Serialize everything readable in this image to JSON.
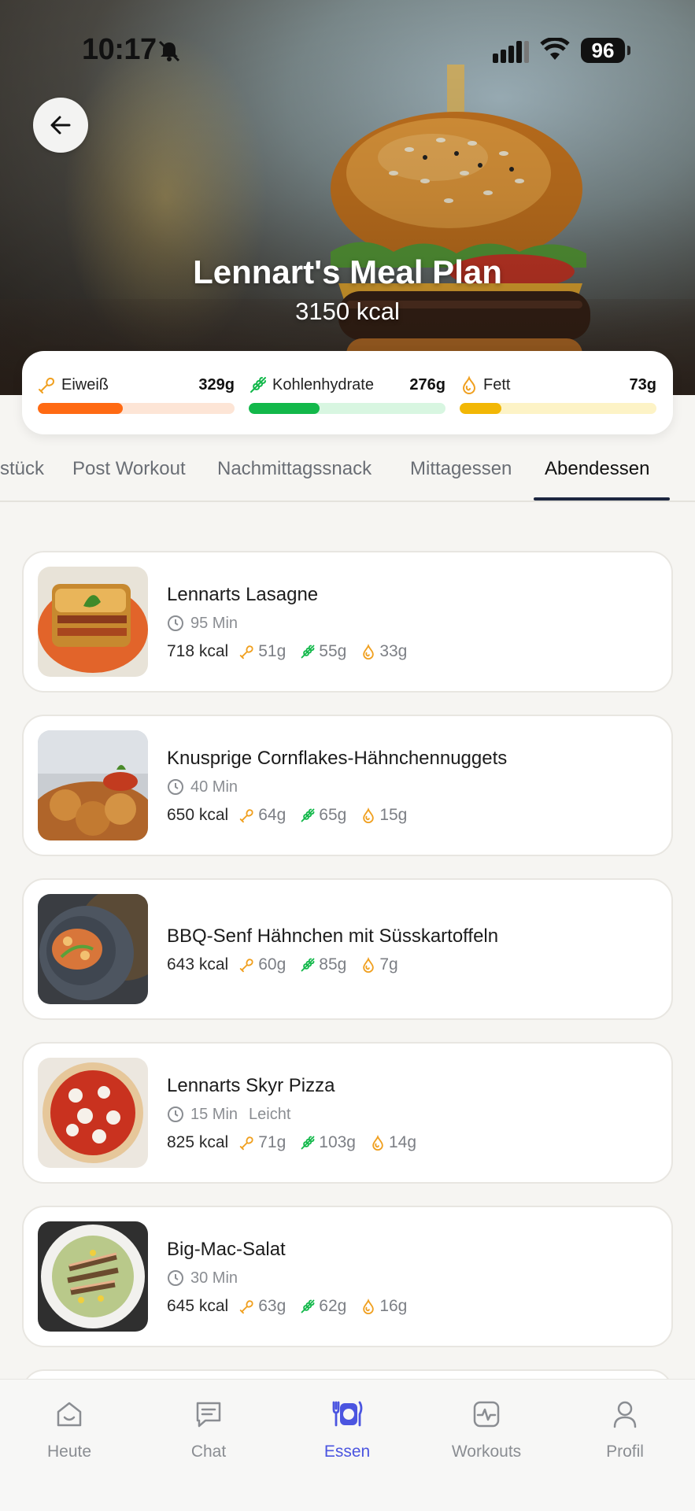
{
  "status_bar": {
    "time": "10:17",
    "battery": "96"
  },
  "header": {
    "title": "Lennart's Meal Plan",
    "kcal": "3150 kcal"
  },
  "macros": [
    {
      "icon": "protein-icon",
      "label": "Eiweiß",
      "value": "329g",
      "fill": 0.43,
      "color": "#ff6a13",
      "track": "#fde5d6"
    },
    {
      "icon": "carbs-icon",
      "label": "Kohlenhydrate",
      "value": "276g",
      "fill": 0.36,
      "color": "#12b84a",
      "track": "#d8f6e1"
    },
    {
      "icon": "fat-icon",
      "label": "Fett",
      "value": "73g",
      "fill": 0.21,
      "color": "#f2b705",
      "track": "#fdf3c6"
    }
  ],
  "tabs": [
    "stück",
    "Post Workout",
    "Nachmittagssnack",
    "Mittagessen",
    "Abendessen"
  ],
  "active_tab": "Abendessen",
  "meals": [
    {
      "name": "Lennarts Lasagne",
      "time": "95 Min",
      "level": "",
      "kcal": "718 kcal",
      "protein": "51g",
      "carbs": "55g",
      "fat": "33g"
    },
    {
      "name": "Knusprige Cornflakes-Hähnchennuggets",
      "time": "40 Min",
      "level": "",
      "kcal": "650 kcal",
      "protein": "64g",
      "carbs": "65g",
      "fat": "15g"
    },
    {
      "name": "BBQ-Senf Hähnchen mit Süsskartoffeln",
      "time": "",
      "level": "",
      "kcal": "643 kcal",
      "protein": "60g",
      "carbs": "85g",
      "fat": "7g"
    },
    {
      "name": "Lennarts Skyr Pizza",
      "time": "15 Min",
      "level": "Leicht",
      "kcal": "825 kcal",
      "protein": "71g",
      "carbs": "103g",
      "fat": "14g"
    },
    {
      "name": "Big-Mac-Salat",
      "time": "30 Min",
      "level": "",
      "kcal": "645 kcal",
      "protein": "63g",
      "carbs": "62g",
      "fat": "16g"
    }
  ],
  "nav": [
    {
      "label": "Heute",
      "icon": "home-icon"
    },
    {
      "label": "Chat",
      "icon": "chat-icon"
    },
    {
      "label": "Essen",
      "icon": "food-icon"
    },
    {
      "label": "Workouts",
      "icon": "workouts-icon"
    },
    {
      "label": "Profil",
      "icon": "profile-icon"
    }
  ],
  "colors": {
    "accent": "#4b55e0",
    "tab_underline": "#1d2740"
  }
}
